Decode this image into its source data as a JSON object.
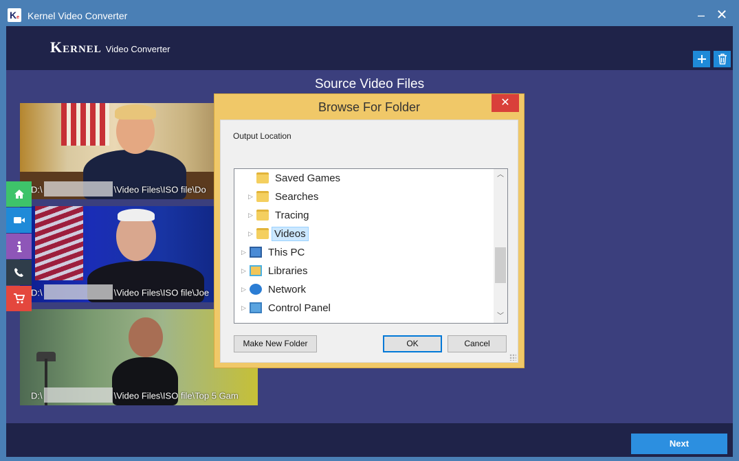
{
  "window": {
    "title": "Kernel Video Converter",
    "minimize": "–",
    "close": "✕"
  },
  "brand": {
    "name": "Kernel",
    "product": "Video Converter"
  },
  "header": {
    "add_icon": "plus-icon",
    "delete_icon": "trash-icon"
  },
  "section": {
    "title": "Source Video Files"
  },
  "videos": [
    {
      "path_prefix": "D:\\",
      "path_suffix": "\\Video Files\\ISO file\\Do"
    },
    {
      "path_prefix": "D:\\",
      "path_suffix": "\\Video Files\\ISO file\\Joe"
    },
    {
      "path_prefix": "D:\\",
      "path_suffix": "\\Video Files\\ISO file\\Top 5 Gam"
    }
  ],
  "sidebar": [
    {
      "icon": "home-icon",
      "color": "#3ec36a"
    },
    {
      "icon": "video-camera-icon",
      "color": "#1f8ad8"
    },
    {
      "icon": "info-icon",
      "color": "#8e56b8"
    },
    {
      "icon": "phone-icon",
      "color": "#2f3d4a"
    },
    {
      "icon": "cart-icon",
      "color": "#e4473d"
    }
  ],
  "dialog": {
    "title": "Browse For Folder",
    "close": "✕",
    "label": "Output Location",
    "tree": [
      {
        "label": "Saved Games",
        "icon": "saved-games-folder-icon",
        "expandable": false,
        "selected": false
      },
      {
        "label": "Searches",
        "icon": "searches-folder-icon",
        "expandable": true,
        "selected": false
      },
      {
        "label": "Tracing",
        "icon": "folder-icon",
        "expandable": true,
        "selected": false
      },
      {
        "label": "Videos",
        "icon": "videos-folder-icon",
        "expandable": true,
        "selected": true
      },
      {
        "label": "This PC",
        "icon": "computer-icon",
        "expandable": true,
        "selected": false
      },
      {
        "label": "Libraries",
        "icon": "libraries-icon",
        "expandable": true,
        "selected": false
      },
      {
        "label": "Network",
        "icon": "network-icon",
        "expandable": true,
        "selected": false
      },
      {
        "label": "Control Panel",
        "icon": "control-panel-icon",
        "expandable": true,
        "selected": false
      }
    ],
    "buttons": {
      "new_folder": "Make New Folder",
      "ok": "OK",
      "cancel": "Cancel"
    }
  },
  "footer": {
    "next": "Next"
  },
  "colors": {
    "title_bar": "#4a7fb5",
    "header": "#1f2349",
    "body": "#3b3f7d",
    "dialog_frame": "#f0c868",
    "accent": "#2c8fe0"
  }
}
